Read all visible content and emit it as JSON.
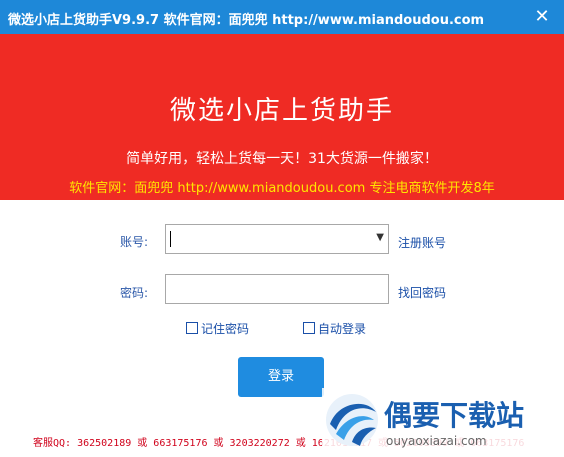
{
  "window": {
    "title": "微选小店上货助手V9.9.7  软件官网：面兜兜 http://www.miandoudou.com",
    "close_glyph": "✕"
  },
  "banner": {
    "app_name": "微选小店上货助手",
    "slogan": "简单好用，轻松上货每一天！31大货源一件搬家！",
    "site_line": "软件官网：面兜兜 http://www.miandoudou.com 专注电商软件开发8年"
  },
  "form": {
    "account_label": "账号:",
    "account_value": "",
    "register_link": "注册账号",
    "password_label": "密码:",
    "password_value": "",
    "recover_link": "找回密码",
    "remember_password": "记住密码",
    "auto_login": "自动登录",
    "login_button": "登录"
  },
  "footer": {
    "contact": "客服QQ: 362502189 或 663175176 或 3203220272 或 1621010917 或 502193399 或 663175176"
  },
  "watermark": {
    "brand": "偶要下载站",
    "url": "ouyaoxiazai.com"
  },
  "colors": {
    "titlebar": "#1e88d8",
    "banner": "#ef2b24",
    "site_line": "#ffe600",
    "button": "#1f8ce0",
    "footer_text": "#d0021b"
  }
}
